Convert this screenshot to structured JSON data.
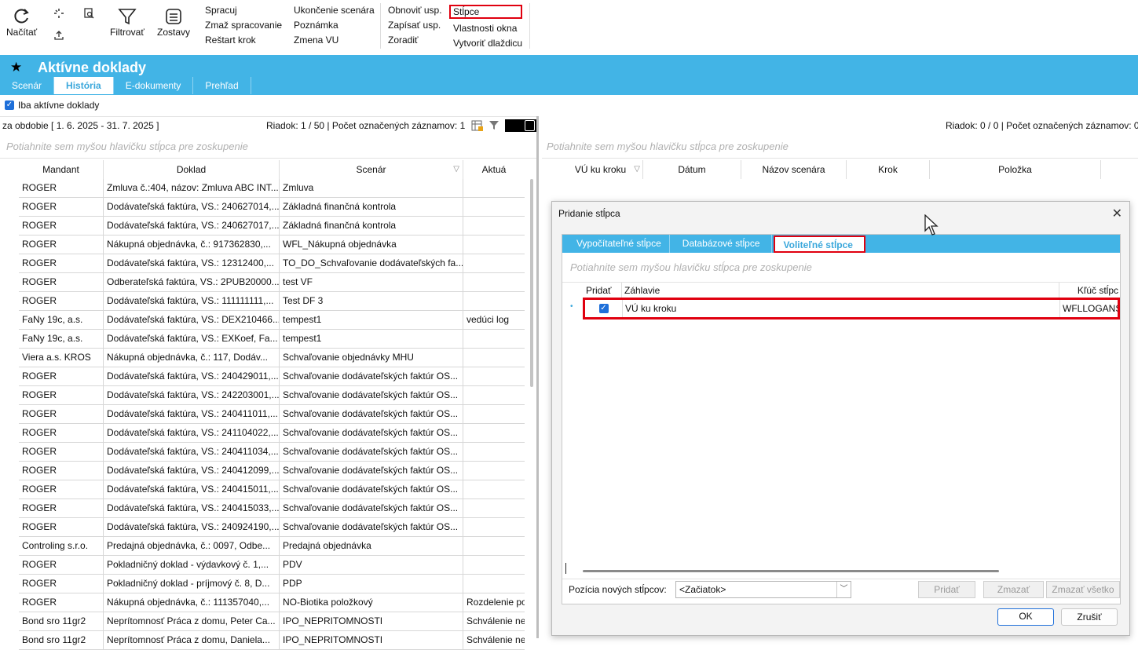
{
  "ribbon": {
    "nacitat": "Načítať",
    "filtrovat": "Filtrovať",
    "zostavy": "Zostavy",
    "col1": [
      "Spracuj",
      "Zmaž spracovanie",
      "Reštart krok"
    ],
    "col2": [
      "Ukončenie scenára",
      "Poznámka",
      "Zmena VU"
    ],
    "col3": [
      "Obnoviť usp.",
      "Zapísať usp.",
      "Zoradiť"
    ],
    "col4": [
      "Stĺpce",
      "Vlastnosti okna",
      "Vytvoriť dlaždicu"
    ]
  },
  "header": {
    "star": "★",
    "title": "Aktívne doklady",
    "tabs": [
      "Scenár",
      "História",
      "E-dokumenty",
      "Prehľad"
    ]
  },
  "filter": {
    "checkbox_label": "Iba aktívne doklady"
  },
  "left": {
    "period": "za obdobie [ 1. 6. 2025 - 31. 7. 2025 ]",
    "status": "Riadok: 1 / 50 | Počet označených záznamov: 1",
    "group_hint": "Potiahnite sem myšou hlavičku stĺpca pre zoskupenie",
    "columns": [
      "Mandant",
      "Doklad",
      "Scenár",
      "Aktuá"
    ],
    "rows": [
      [
        "ROGER",
        "Zmluva č.:404, názov: Zmluva ABC INT...",
        "Zmluva",
        ""
      ],
      [
        "ROGER",
        "Dodávateľská faktúra, VS.: 240627014,...",
        "Základná finančná kontrola",
        ""
      ],
      [
        "ROGER",
        "Dodávateľská faktúra, VS.: 240627017,...",
        "Základná finančná kontrola",
        ""
      ],
      [
        "ROGER",
        "Nákupná objednávka,  č.: 917362830,...",
        "WFL_Nákupná objednávka",
        ""
      ],
      [
        "ROGER",
        "Dodávateľská faktúra, VS.: 12312400,...",
        "TO_DO_Schvaľovanie dodávateľských  fa...",
        ""
      ],
      [
        "ROGER",
        "Odberateľská faktúra, VS.: 2PUB20000...",
        "test VF",
        ""
      ],
      [
        "ROGER",
        "Dodávateľská faktúra, VS.: 111111111,...",
        "Test DF 3",
        ""
      ],
      [
        "FaNy 19c, a.s.",
        "Dodávateľská faktúra, VS.: DEX210466...",
        "tempest1",
        "vedúci log"
      ],
      [
        "FaNy 19c, a.s.",
        "Dodávateľská faktúra, VS.: EXKoef,  Fa...",
        "tempest1",
        ""
      ],
      [
        "Viera a.s. KROS",
        "Nákupná objednávka,  č.: 117,  Dodáv...",
        "Schvaľovanie objednávky MHU",
        ""
      ],
      [
        "ROGER",
        "Dodávateľská faktúra, VS.: 240429011,...",
        "Schvaľovanie dodávateľských faktúr OS...",
        ""
      ],
      [
        "ROGER",
        "Dodávateľská faktúra, VS.: 242203001,...",
        "Schvaľovanie dodávateľských faktúr OS...",
        ""
      ],
      [
        "ROGER",
        "Dodávateľská faktúra, VS.: 240411011,...",
        "Schvaľovanie dodávateľských faktúr OS...",
        ""
      ],
      [
        "ROGER",
        "Dodávateľská faktúra, VS.: 241104022,...",
        "Schvaľovanie dodávateľských faktúr OS...",
        ""
      ],
      [
        "ROGER",
        "Dodávateľská faktúra, VS.: 240411034,...",
        "Schvaľovanie dodávateľských faktúr OS...",
        ""
      ],
      [
        "ROGER",
        "Dodávateľská faktúra, VS.: 240412099,...",
        "Schvaľovanie dodávateľských faktúr OS...",
        ""
      ],
      [
        "ROGER",
        "Dodávateľská faktúra, VS.: 240415011,...",
        "Schvaľovanie dodávateľských faktúr OS...",
        ""
      ],
      [
        "ROGER",
        "Dodávateľská faktúra, VS.: 240415033,...",
        "Schvaľovanie dodávateľských faktúr OS...",
        ""
      ],
      [
        "ROGER",
        "Dodávateľská faktúra, VS.: 240924190,...",
        "Schvaľovanie dodávateľských faktúr OS...",
        ""
      ],
      [
        "Controling s.r.o.",
        "Predajná objednávka,  č.: 0097,  Odbe...",
        "Predajná objednávka",
        ""
      ],
      [
        "ROGER",
        "Pokladničný doklad - výdavkový č. 1,...",
        "PDV",
        ""
      ],
      [
        "ROGER",
        "Pokladničný doklad - príjmový č. 8, D...",
        "PDP",
        ""
      ],
      [
        "ROGER",
        "Nákupná objednávka,  č.: 111357040,...",
        "NO-Biotika položkový",
        "Rozdelenie po"
      ],
      [
        "Bond sro 11gr2",
        "Neprítomnosť Práca z domu, Peter Ca...",
        "IPO_NEPRITOMNOSTI",
        "Schválenie  ne"
      ],
      [
        "Bond sro 11gr2",
        "Neprítomnosť Práca z domu, Daniela...",
        "IPO_NEPRITOMNOSTI",
        "Schválenie  ne"
      ]
    ]
  },
  "right": {
    "status": "Riadok: 0 / 0 | Počet označených záznamov: 0",
    "group_hint": "Potiahnite sem myšou hlavičku stĺpca pre zoskupenie",
    "columns": [
      "VÚ ku kroku",
      "Dátum",
      "Názov scenára",
      "Krok",
      "Položka"
    ]
  },
  "dialog": {
    "title": "Pridanie stĺpca",
    "tabs": [
      "Vypočítateľné stĺpce",
      "Databázové stĺpce",
      "Voliteľné stĺpce"
    ],
    "group_hint": "Potiahnite sem myšou hlavičku stĺpca pre zoskupenie",
    "columns": [
      "Pridať",
      "Záhlavie",
      "Kľúč stĺpc"
    ],
    "row": {
      "header": "VÚ ku kroku",
      "key": "WFLLOGANSV"
    },
    "position_label": "Pozícia nových stĺpcov:",
    "position_value": "<Začiatok>",
    "btn_add": "Pridať",
    "btn_delete": "Zmazať",
    "btn_delete_all": "Zmazať všetko",
    "btn_ok": "OK",
    "btn_cancel": "Zrušiť"
  }
}
